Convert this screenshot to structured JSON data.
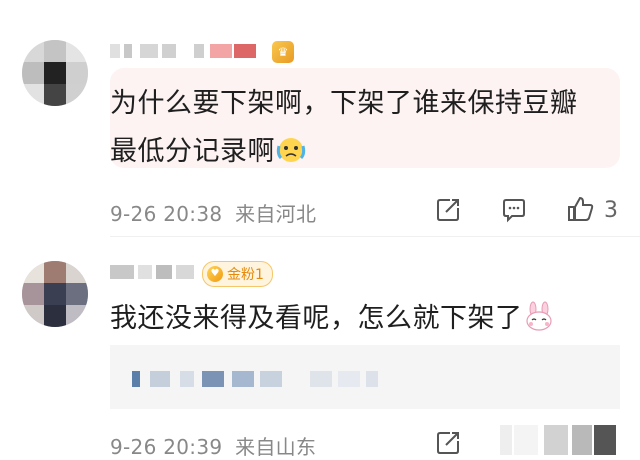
{
  "comments": [
    {
      "text_line1": "为什么要下架啊，下架了谁来保持豆瓣",
      "text_line2": "最低分记录啊",
      "date": "9-26 20:38",
      "location": "来自河北",
      "likes": "3",
      "user_badge_icon": "fan-level-badge-icon",
      "emoji_icon": "crying-emoji-icon"
    },
    {
      "text": "我还没来得及看呢，怎么就下架了",
      "date": "9-26 20:39",
      "location": "来自山东",
      "fan_badge": "金粉1",
      "emoji_icon": "bunny-emoji-icon"
    }
  ],
  "colors": {
    "text": "#1f1f1f",
    "meta": "#888888",
    "bubble_bg": "#fdf3f3",
    "quote_bg": "#f5f5f5",
    "badge_orange": "#e48a0c"
  }
}
